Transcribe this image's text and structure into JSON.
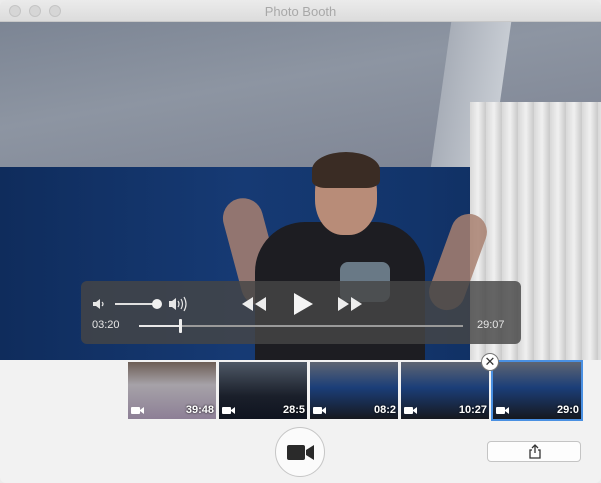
{
  "window": {
    "title": "Photo Booth"
  },
  "player": {
    "current_time": "03:20",
    "total_time": "29:07",
    "progress": 0.125,
    "volume": 0.85
  },
  "thumbnails": [
    {
      "duration": "39:48",
      "selected": false
    },
    {
      "duration": "28:5",
      "selected": false
    },
    {
      "duration": "08:2",
      "selected": false
    },
    {
      "duration": "10:27",
      "selected": false
    },
    {
      "duration": "29:0",
      "selected": true
    }
  ],
  "icons": {
    "volume_low": "speaker-low-icon",
    "volume_high": "speaker-high-icon",
    "rewind": "rewind-icon",
    "play": "play-icon",
    "forward": "fast-forward-icon",
    "thumb_camera": "video-camera-icon",
    "record": "video-camera-icon",
    "share": "share-icon",
    "close": "close-icon"
  },
  "colors": {
    "selection": "#4a90e2",
    "hud_background": "#464646"
  }
}
